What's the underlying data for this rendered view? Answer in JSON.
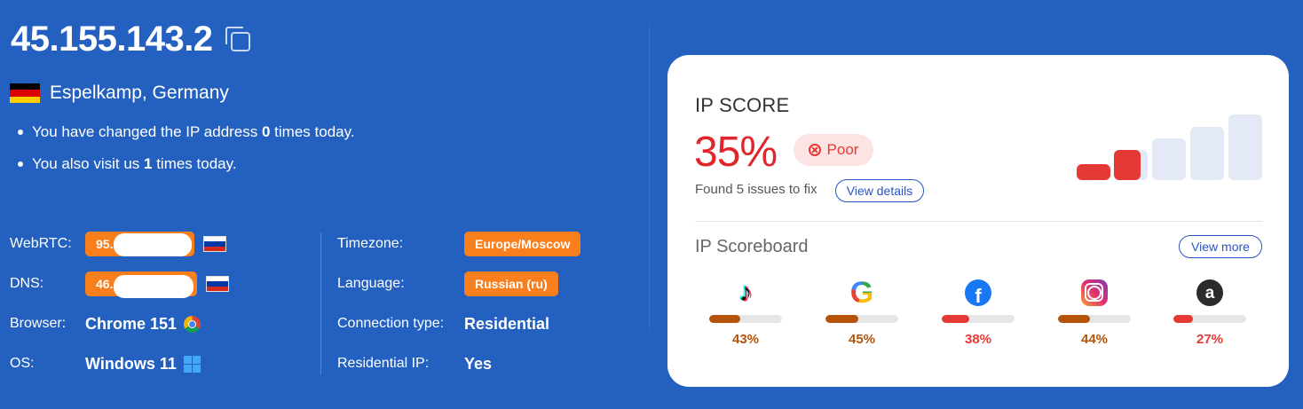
{
  "ip": "45.155.143.2",
  "location": "Espelkamp, Germany",
  "notes": {
    "line1_prefix": "You have changed the IP address ",
    "line1_count": "0",
    "line1_suffix": " times today.",
    "line2_prefix": "You also visit us ",
    "line2_count": "1",
    "line2_suffix": " times today."
  },
  "details": {
    "webrtc_label": "WebRTC:",
    "webrtc_value": "95.",
    "dns_label": "DNS:",
    "dns_value": "46.",
    "browser_label": "Browser:",
    "browser_value": "Chrome 151",
    "os_label": "OS:",
    "os_value": "Windows 11",
    "timezone_label": "Timezone:",
    "timezone_value": "Europe/Moscow",
    "language_label": "Language:",
    "language_value": "Russian (ru)",
    "conn_label": "Connection type:",
    "conn_value": "Residential",
    "resip_label": "Residential IP:",
    "resip_value": "Yes"
  },
  "score_card": {
    "title": "IP SCORE",
    "score": "35%",
    "rating": "Poor",
    "issues": "Found 5 issues to fix",
    "details_button": "View details",
    "scoreboard_title": "IP Scoreboard",
    "more_button": "View more",
    "sites": [
      {
        "name": "tiktok-icon",
        "glyph": "♪",
        "value": "43%",
        "fraction": 0.43,
        "color": "#b45309"
      },
      {
        "name": "google-icon",
        "glyph": "G",
        "value": "45%",
        "fraction": 0.45,
        "color": "#b45309"
      },
      {
        "name": "facebook-icon",
        "glyph": "f",
        "value": "38%",
        "fraction": 0.38,
        "color": "#e53935"
      },
      {
        "name": "instagram-icon",
        "glyph": "",
        "value": "44%",
        "fraction": 0.44,
        "color": "#b45309"
      },
      {
        "name": "amazon-icon",
        "glyph": "a",
        "value": "27%",
        "fraction": 0.27,
        "color": "#e53935"
      }
    ],
    "colors": {
      "bad": "#e53935",
      "medium": "#b45309",
      "bar_inactive": "#e3e9f7"
    }
  }
}
